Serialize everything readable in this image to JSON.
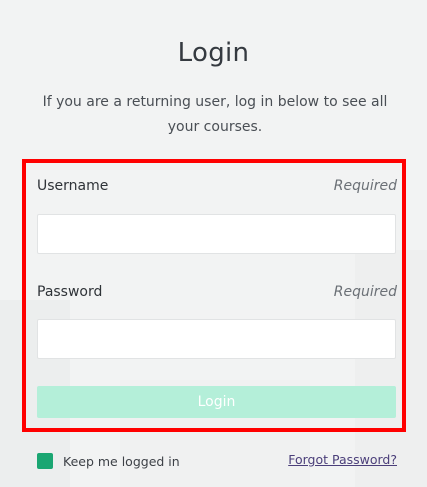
{
  "login": {
    "title": "Login",
    "subtitle": "If you are a returning user, log in below to see all your courses.",
    "username": {
      "label": "Username",
      "required_text": "Required",
      "value": "",
      "placeholder": ""
    },
    "password": {
      "label": "Password",
      "required_text": "Required",
      "value": "",
      "placeholder": ""
    },
    "submit_label": "Login",
    "remember_me_label": "Keep me logged in",
    "remember_me_checked": true,
    "forgot_password_label": "Forgot Password?"
  },
  "colors": {
    "accent": "#1aa672",
    "button_disabled": "#b4efd9",
    "highlight_frame": "#ff0000",
    "link": "#4b3f7a",
    "background": "#f2f3f3"
  }
}
